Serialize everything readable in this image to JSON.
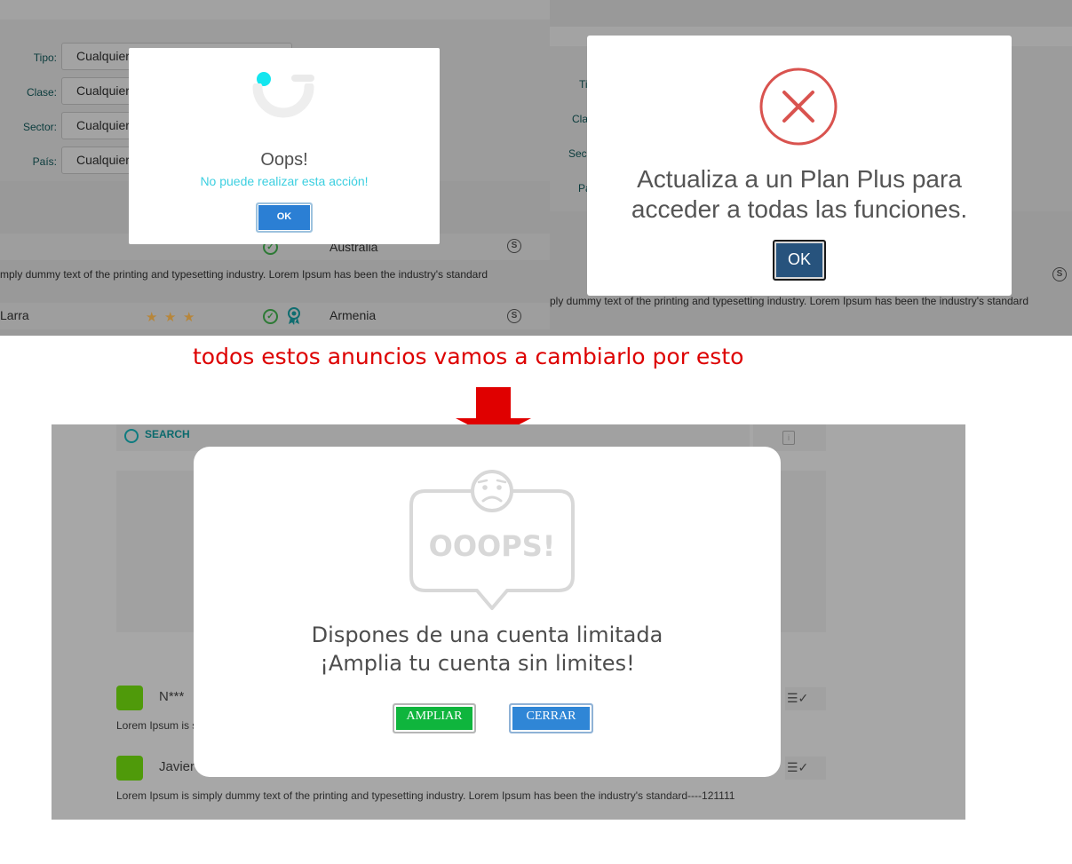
{
  "panel1": {
    "filters": [
      {
        "label": "Tipo:",
        "value": "Cualquier"
      },
      {
        "label": "Clase:",
        "value": "Cualquier"
      },
      {
        "label": "Sector:",
        "value": "Cualquier"
      },
      {
        "label": "País:",
        "value": "Cualquier"
      }
    ],
    "rows": [
      {
        "country": "Australia"
      },
      {
        "name": "Larra",
        "country": "Armenia"
      }
    ],
    "lorem": "mply dummy text of the printing and typesetting industry. Lorem Ipsum has been the industry's standard",
    "star": "★",
    "check": "✓",
    "skype": "S",
    "dialog": {
      "title": "Oops!",
      "message": "No puede realizar esta acción!",
      "ok": "OK",
      "accent": "#14e6ef"
    }
  },
  "panel2": {
    "labels": [
      "Ti",
      "Cla",
      "Sec",
      "Pa"
    ],
    "lorem": "ply dummy text of the printing and typesetting industry. Lorem Ipsum has been the industry's standard",
    "skype": "S",
    "dialog": {
      "message_line1": "Actualiza a un Plan Plus para",
      "message_line2": "acceder a todas las funciones.",
      "ok": "OK",
      "icon": "error-x-icon",
      "icon_color": "#d9534f"
    }
  },
  "annotation": {
    "text": "todos estos anuncios vamos a cambiarlo por esto",
    "color": "#dd0000"
  },
  "panel3": {
    "search_label": "SEARCH",
    "info_icon": "i",
    "list_icon": "☰✓",
    "rows": [
      {
        "name": "N***",
        "lorem": "Lorem Ipsum is s"
      },
      {
        "name": "Javier",
        "lorem": "Lorem Ipsum is simply dummy text of the printing and typesetting industry. Lorem Ipsum has been the industry's standard----121111"
      }
    ],
    "dialog": {
      "badge_text": "OOOPS!",
      "message_line1": "Dispones de una cuenta limitada",
      "message_line2": "¡Amplia tu cuenta sin limites!",
      "primary_button": "AMPLIAR",
      "secondary_button": "CERRAR",
      "primary_color": "#0fb53d",
      "secondary_color": "#2f86d6"
    }
  }
}
